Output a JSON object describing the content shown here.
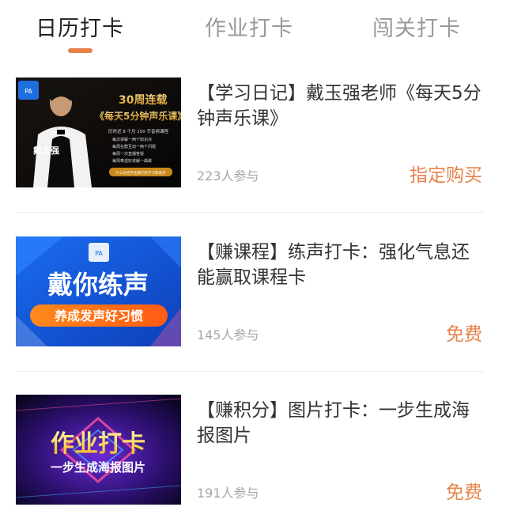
{
  "tabs": [
    {
      "label": "日历打卡",
      "active": true
    },
    {
      "label": "作业打卡",
      "active": false
    },
    {
      "label": "闯关打卡",
      "active": false
    }
  ],
  "accent_color": "#e7824a",
  "items": [
    {
      "title": "【学习日记】戴玉强老师《每天5分钟声乐课》",
      "participants": "223人参与",
      "price": "指定购买",
      "thumbnail": {
        "icon": "course-poster",
        "headline": "30周连载",
        "subtitle": "《每天5分钟声乐课》",
        "teacher": "戴玉强",
        "lines": [
          "历时近 8 个月 150 节音频课程",
          "每次讲解一两个知识点",
          "每周在群互动一两个问题",
          "每周一次直播答疑",
          "每周奉送好讲解一曲歌"
        ],
        "footer": "什么也挡不住我们的学习和进步"
      }
    },
    {
      "title": "【赚课程】练声打卡：强化气息还能赢取课程卡",
      "participants": "145人参与",
      "price": "免费",
      "thumbnail": {
        "icon": "vocal-practice-banner",
        "headline": "戴你练声",
        "subtitle": "养成发声好习惯"
      }
    },
    {
      "title": "【赚积分】图片打卡：一步生成海报图片",
      "participants": "191人参与",
      "price": "免费",
      "thumbnail": {
        "icon": "homework-checkin-banner",
        "headline": "作业打卡",
        "subtitle": "一步生成海报图片"
      }
    }
  ]
}
